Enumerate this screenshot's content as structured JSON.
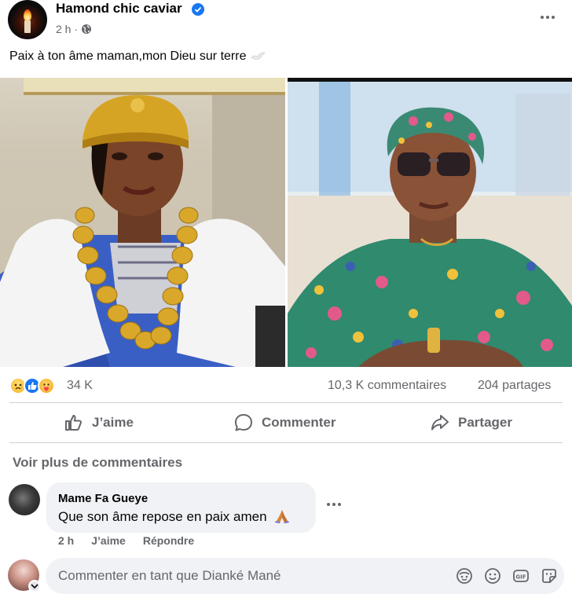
{
  "post": {
    "page_name": "Hamond chic caviar",
    "time": "2 h",
    "meta_separator": "·",
    "text": "Paix à ton âme maman,mon Dieu sur terre"
  },
  "stats": {
    "reaction_count": "34 K",
    "comments": "10,3 K commentaires",
    "shares": "204 partages"
  },
  "actions": {
    "like": "J’aime",
    "comment": "Commenter",
    "share": "Partager"
  },
  "comments_section": {
    "see_more": "Voir plus de commentaires",
    "items": [
      {
        "author": "Mame Fa Gueye",
        "text": "Que son âme repose en paix amen",
        "time": "2 h",
        "like": "J’aime",
        "reply": "Répondre"
      }
    ]
  },
  "composer": {
    "placeholder": "Commenter en tant que Dianké Mané"
  },
  "colors": {
    "accent": "#1877f2",
    "secondary_text": "#65676b",
    "bubble": "#f0f2f5"
  }
}
